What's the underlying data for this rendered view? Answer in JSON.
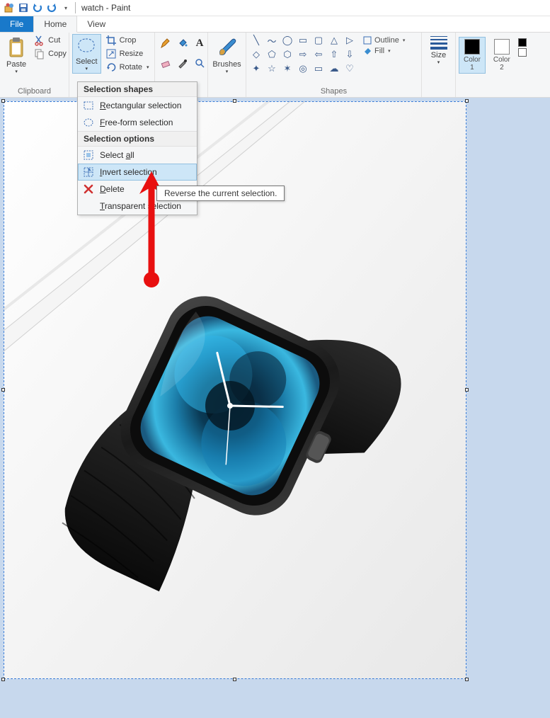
{
  "titlebar": {
    "title": "watch - Paint"
  },
  "tabs": {
    "file": "File",
    "home": "Home",
    "view": "View"
  },
  "ribbon": {
    "clipboard": {
      "label": "Clipboard",
      "paste": "Paste",
      "cut": "Cut",
      "copy": "Copy"
    },
    "image": {
      "select": "Select",
      "crop": "Crop",
      "resize": "Resize",
      "rotate": "Rotate"
    },
    "tools": {
      "brushes": "Brushes"
    },
    "shapes": {
      "label": "Shapes",
      "outline": "Outline",
      "fill": "Fill"
    },
    "size": {
      "label": "Size"
    },
    "colors": {
      "c1top": "Color",
      "c1bot": "1",
      "c2top": "Color",
      "c2bot": "2"
    }
  },
  "dropdown": {
    "head1": "Selection shapes",
    "rect": "Rectangular selection",
    "free": "Free-form selection",
    "head2": "Selection options",
    "selall": "Select all",
    "invert": "Invert selection",
    "delete": "Delete",
    "transparent": "Transparent selection"
  },
  "tooltip": "Reverse the current selection.",
  "mnemonics": {
    "rect": "R",
    "free": "F",
    "selall": "a",
    "invert": "I",
    "delete": "D",
    "transparent": "T"
  }
}
